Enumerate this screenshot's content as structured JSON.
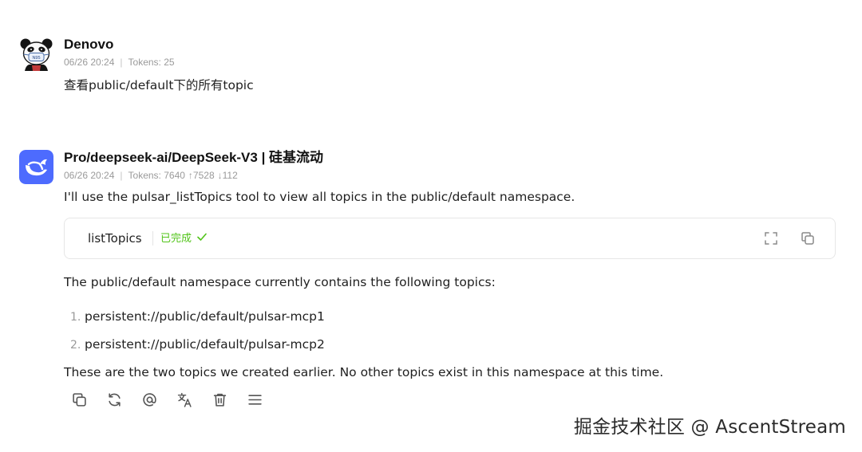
{
  "messages": {
    "user": {
      "avatar_icon": "panda-avatar-icon",
      "name": "Denovo",
      "date": "06/26 20:24",
      "tokens": "Tokens: 25",
      "text": "查看public/default下的所有topic"
    },
    "assistant": {
      "avatar_icon": "deepseek-whale-icon",
      "avatar_color": "#4d6bfe",
      "name": "Pro/deepseek-ai/DeepSeek-V3 | 硅基流动",
      "date": "06/26 20:24",
      "tokens": "Tokens: 7640",
      "tokens_up": "↑7528",
      "tokens_down": "↓112",
      "intro": "I'll use the pulsar_listTopics tool to view all topics in the public/default namespace.",
      "tool": {
        "name": "listTopics",
        "status": "已完成",
        "status_icon": "check-icon",
        "status_color": "#52c41a",
        "actions": [
          "expand-icon",
          "copy-icon"
        ]
      },
      "para1": "The public/default namespace currently contains the following topics:",
      "topics": [
        {
          "num": "1.",
          "text": "persistent://public/default/pulsar-mcp1"
        },
        {
          "num": "2.",
          "text": "persistent://public/default/pulsar-mcp2"
        }
      ],
      "para2": "These are the two topics we created earlier. No other topics exist in this namespace at this time.",
      "toolbar": [
        "copy-icon",
        "regenerate-icon",
        "mention-icon",
        "translate-icon",
        "delete-icon",
        "menu-icon"
      ]
    }
  },
  "watermark": "掘金技术社区 @ AscentStream"
}
